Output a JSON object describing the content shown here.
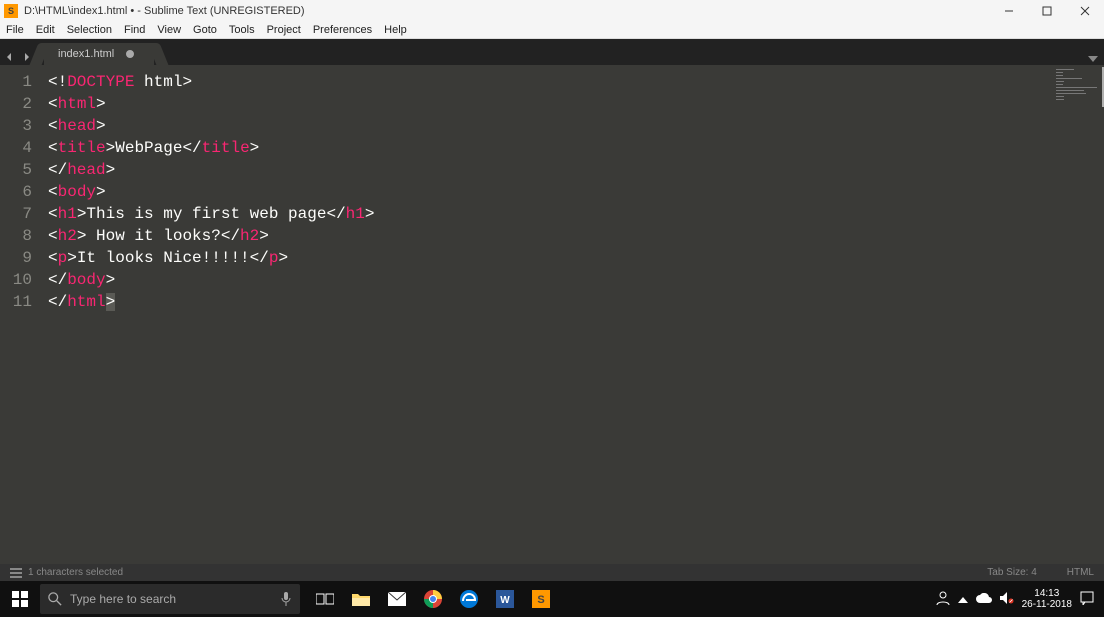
{
  "window": {
    "title": "D:\\HTML\\index1.html • - Sublime Text (UNREGISTERED)"
  },
  "menu": [
    "File",
    "Edit",
    "Selection",
    "Find",
    "View",
    "Goto",
    "Tools",
    "Project",
    "Preferences",
    "Help"
  ],
  "tab": {
    "label": "index1.html",
    "dirty": true
  },
  "code_lines": [
    {
      "n": "1",
      "tokens": [
        {
          "t": "<!",
          "c": "wht"
        },
        {
          "t": "DOCTYPE",
          "c": "pnk"
        },
        {
          "t": " ",
          "c": "wht"
        },
        {
          "t": "html",
          "c": "wht"
        },
        {
          "t": ">",
          "c": "wht"
        }
      ]
    },
    {
      "n": "2",
      "tokens": [
        {
          "t": "<",
          "c": "wht"
        },
        {
          "t": "html",
          "c": "pnk"
        },
        {
          "t": ">",
          "c": "wht"
        }
      ]
    },
    {
      "n": "3",
      "tokens": [
        {
          "t": "<",
          "c": "wht"
        },
        {
          "t": "head",
          "c": "pnk"
        },
        {
          "t": ">",
          "c": "wht"
        }
      ]
    },
    {
      "n": "4",
      "tokens": [
        {
          "t": "<",
          "c": "wht"
        },
        {
          "t": "title",
          "c": "pnk"
        },
        {
          "t": ">",
          "c": "wht"
        },
        {
          "t": "WebPage",
          "c": "wht"
        },
        {
          "t": "</",
          "c": "wht"
        },
        {
          "t": "title",
          "c": "pnk"
        },
        {
          "t": ">",
          "c": "wht"
        }
      ]
    },
    {
      "n": "5",
      "tokens": [
        {
          "t": "</",
          "c": "wht"
        },
        {
          "t": "head",
          "c": "pnk"
        },
        {
          "t": ">",
          "c": "wht"
        }
      ]
    },
    {
      "n": "6",
      "tokens": [
        {
          "t": "<",
          "c": "wht"
        },
        {
          "t": "body",
          "c": "pnk"
        },
        {
          "t": ">",
          "c": "wht"
        }
      ]
    },
    {
      "n": "7",
      "tokens": [
        {
          "t": "<",
          "c": "wht"
        },
        {
          "t": "h1",
          "c": "pnk"
        },
        {
          "t": ">",
          "c": "wht"
        },
        {
          "t": "This is my first web page",
          "c": "wht"
        },
        {
          "t": "</",
          "c": "wht"
        },
        {
          "t": "h1",
          "c": "pnk"
        },
        {
          "t": ">",
          "c": "wht"
        }
      ]
    },
    {
      "n": "8",
      "tokens": [
        {
          "t": "<",
          "c": "wht"
        },
        {
          "t": "h2",
          "c": "pnk"
        },
        {
          "t": ">",
          "c": "wht"
        },
        {
          "t": " How it looks?",
          "c": "wht"
        },
        {
          "t": "</",
          "c": "wht"
        },
        {
          "t": "h2",
          "c": "pnk"
        },
        {
          "t": ">",
          "c": "wht"
        }
      ]
    },
    {
      "n": "9",
      "tokens": [
        {
          "t": "<",
          "c": "wht"
        },
        {
          "t": "p",
          "c": "pnk"
        },
        {
          "t": ">",
          "c": "wht"
        },
        {
          "t": "It looks Nice!!!!!",
          "c": "wht"
        },
        {
          "t": "</",
          "c": "wht"
        },
        {
          "t": "p",
          "c": "pnk"
        },
        {
          "t": ">",
          "c": "wht"
        }
      ]
    },
    {
      "n": "10",
      "tokens": [
        {
          "t": "</",
          "c": "wht"
        },
        {
          "t": "body",
          "c": "pnk"
        },
        {
          "t": ">",
          "c": "wht"
        }
      ]
    },
    {
      "n": "11",
      "tokens": [
        {
          "t": "</",
          "c": "wht"
        },
        {
          "t": "html",
          "c": "pnk"
        },
        {
          "t": ">",
          "c": "wht",
          "sel": true
        }
      ]
    }
  ],
  "status": {
    "left": "1 characters selected",
    "tab_size": "Tab Size: 4",
    "lang": "HTML"
  },
  "taskbar": {
    "search_placeholder": "Type here to search",
    "clock_time": "14:13",
    "clock_date": "26-11-2018"
  }
}
